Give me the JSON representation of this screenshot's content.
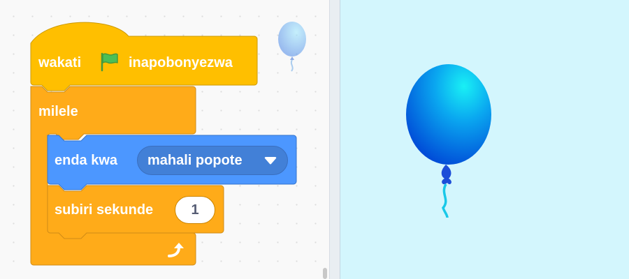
{
  "blocks": {
    "hat": {
      "prefix": "wakati",
      "suffix": "inapobonyezwa",
      "flag_icon": "green-flag-icon"
    },
    "forever": {
      "label": "milele",
      "loop_icon": "loop-arrow-icon"
    },
    "goto": {
      "label": "enda kwa",
      "dropdown_value": "mahali popote"
    },
    "wait": {
      "label": "subiri sekunde",
      "value": "1"
    }
  },
  "colors": {
    "events": "#ffbf00",
    "control": "#ffab19",
    "motion": "#4c97ff",
    "stage_bg": "#d3f6fd"
  }
}
